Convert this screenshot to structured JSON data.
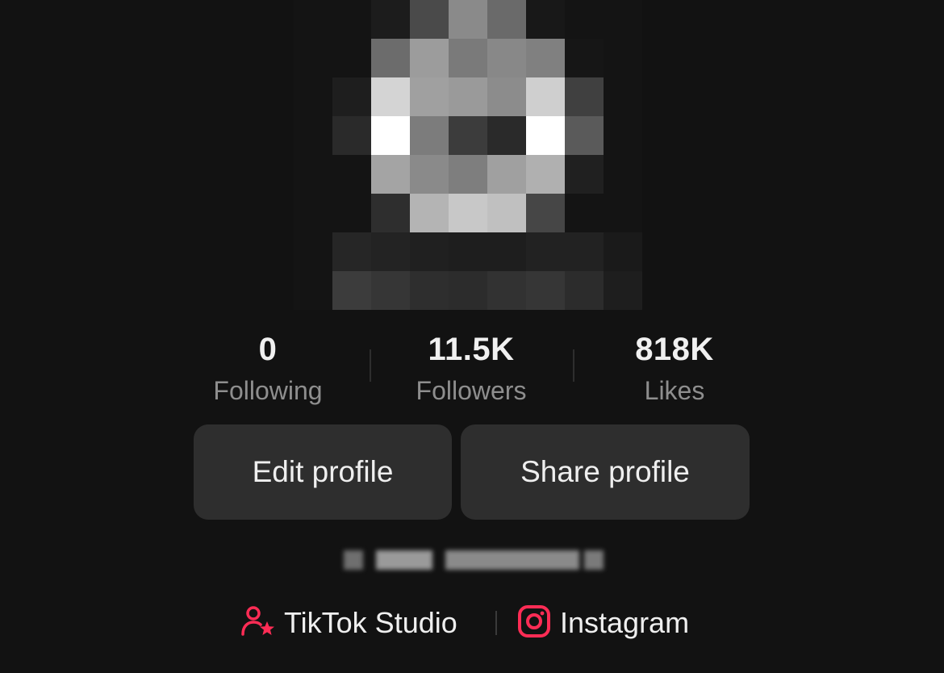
{
  "profile": {
    "stats": [
      {
        "value": "0",
        "label": "Following"
      },
      {
        "value": "11.5K",
        "label": "Followers"
      },
      {
        "value": "818K",
        "label": "Likes"
      }
    ],
    "buttons": {
      "edit_label": "Edit profile",
      "share_label": "Share profile"
    },
    "links": {
      "studio_label": "TikTok Studio",
      "studio_icon": "user-star-icon",
      "instagram_label": "Instagram",
      "instagram_icon": "instagram-icon"
    },
    "colors": {
      "accent": "#fe2c55",
      "background": "#121212",
      "button": "#2e2e2e"
    }
  }
}
